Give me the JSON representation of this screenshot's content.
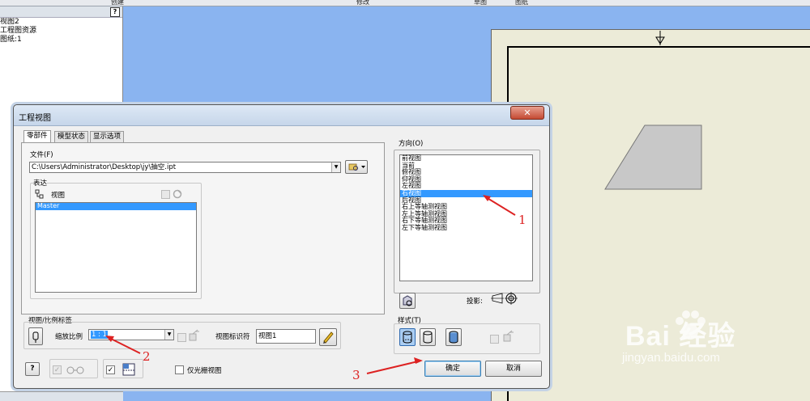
{
  "topbar": {
    "labels": [
      "创建",
      "修改",
      "草图",
      "图纸"
    ]
  },
  "browser": {
    "items": [
      "视图2",
      "工程图资源",
      "图纸:1"
    ],
    "help": "?"
  },
  "dialog": {
    "title": "工程视图",
    "close": "✕",
    "tabs": [
      "零部件",
      "模型状态",
      "显示选项"
    ],
    "file": {
      "label": "文件(F)",
      "value": "C:\\Users\\Administrator\\Desktop\\jy\\抽空.ipt"
    },
    "representation": {
      "group": "表达",
      "view_label": "视图",
      "list": [
        "Master"
      ]
    },
    "direction": {
      "label": "方向(O)",
      "options": [
        "前视图",
        "当前",
        "俯视图",
        "仰视图",
        "左视图",
        "右视图",
        "后视图",
        "右上等轴测视图",
        "左上等轴测视图",
        "右下等轴测视图",
        "左下等轴测视图"
      ],
      "selected_index": 5
    },
    "projection_label": "投影:",
    "view_scale": {
      "group": "视图/比例标签",
      "scale_label": "缩放比例",
      "scale_value": "1 : 1",
      "identifier_label": "视图标识符",
      "identifier_value": "视图1"
    },
    "style_label": "样式(T)",
    "raster_label": "仅光栅视图",
    "ok": "确定",
    "cancel": "取消",
    "help": "?"
  },
  "annotations": [
    "1",
    "2",
    "3"
  ],
  "watermark": {
    "logo": "Bai 经验",
    "url": "jingyan.baidu.com"
  },
  "colors": {
    "selection": "#3399ff",
    "arrow": "#dd2222",
    "workspace": "#8ab4f0",
    "sheet": "#ecebd8"
  }
}
